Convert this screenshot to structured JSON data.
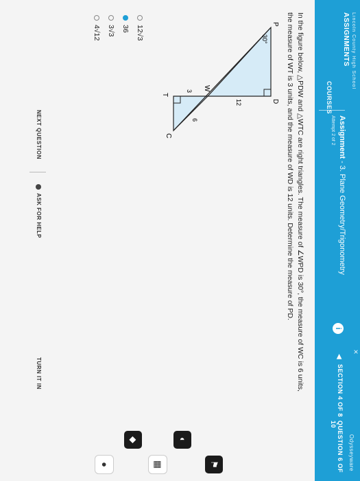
{
  "header": {
    "school": "Lincoln County High School",
    "nav_assignments": "ASSIGNMENTS",
    "nav_courses": "COURSES",
    "assignment_label": "Assignment",
    "assignment_title": "- 3. Plane Geometry/Trigonometry",
    "assignment_sub": "Attempt 2 of 2",
    "brand": "Odysseyware",
    "close_icon": "×",
    "info_icon": "i",
    "section": "SECTION 4 OF 8",
    "question": "QUESTION 6 OF 10"
  },
  "question": {
    "line1": "In the figure below, △PDW and △WTC are right triangles. The measure of ∠WPD is 30°, the measure of WC is 6 units,",
    "line2": "the measure of WT is 3 units, and the measure of WD is 12 units. Determine the measure of PD."
  },
  "figure": {
    "label_P": "P",
    "label_D": "D",
    "label_W": "W",
    "label_T": "T",
    "label_C": "C",
    "angle": "30°",
    "len_WD": "12",
    "len_WT": "3",
    "len_WC": "6"
  },
  "choices": [
    {
      "label": "12√3",
      "selected": false
    },
    {
      "label": "36",
      "selected": true
    },
    {
      "label": "3√3",
      "selected": false
    },
    {
      "label": "4√12",
      "selected": false
    }
  ],
  "footer": {
    "next": "NEXT QUESTION",
    "help": "ASK FOR HELP",
    "turn_in": "TURN IT IN"
  },
  "tools": [
    {
      "name": "flag-icon",
      "glyph": "⚑"
    },
    {
      "name": "globe-icon",
      "glyph": "◐"
    },
    {
      "name": "calculator-icon",
      "glyph": "▦"
    },
    {
      "name": "volume-icon",
      "glyph": "◆"
    },
    {
      "name": "microphone-icon",
      "glyph": "●"
    }
  ],
  "colors": {
    "accent": "#1e9fd6",
    "triangle_fill": "#d6ebf7"
  }
}
